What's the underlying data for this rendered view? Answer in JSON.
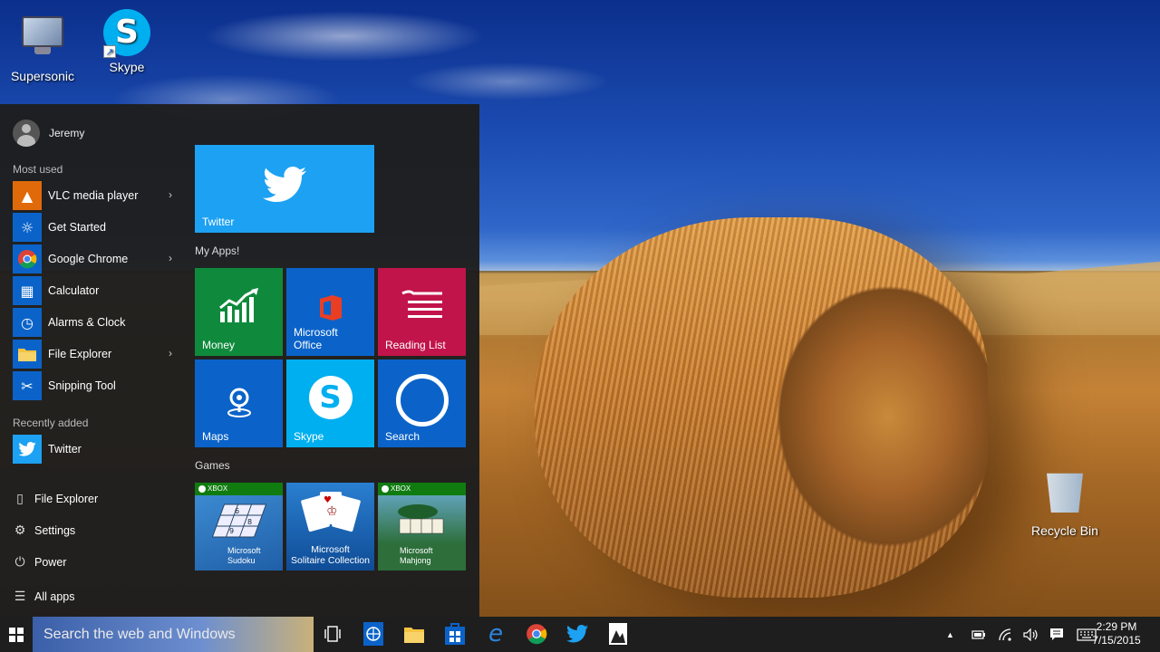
{
  "desktop": {
    "icons": [
      {
        "label": "Supersonic",
        "icon": "computer-icon"
      },
      {
        "label": "Skype",
        "icon": "skype-icon"
      },
      {
        "label": "Recycle Bin",
        "icon": "recycle-bin-icon"
      }
    ]
  },
  "start_menu": {
    "user": "Jeremy",
    "most_used_label": "Most used",
    "most_used": [
      {
        "label": "VLC media player",
        "icon": "vlc-icon",
        "color": "#e06a0a",
        "has_submenu": true
      },
      {
        "label": "Get Started",
        "icon": "lightbulb-icon",
        "color": "#0b63c9",
        "has_submenu": false
      },
      {
        "label": "Google Chrome",
        "icon": "chrome-icon",
        "color": "#0b63c9",
        "has_submenu": true
      },
      {
        "label": "Calculator",
        "icon": "calculator-icon",
        "color": "#0b63c9",
        "has_submenu": false
      },
      {
        "label": "Alarms & Clock",
        "icon": "alarm-clock-icon",
        "color": "#0b63c9",
        "has_submenu": false
      },
      {
        "label": "File Explorer",
        "icon": "folder-icon",
        "color": "#0b63c9",
        "has_submenu": true
      },
      {
        "label": "Snipping Tool",
        "icon": "scissors-icon",
        "color": "#0b63c9",
        "has_submenu": false
      }
    ],
    "recently_added_label": "Recently added",
    "recently_added": [
      {
        "label": "Twitter",
        "icon": "twitter-icon",
        "color": "#1da1f2"
      }
    ],
    "bottom": [
      {
        "label": "File Explorer",
        "icon": "file-explorer-icon"
      },
      {
        "label": "Settings",
        "icon": "gear-icon"
      },
      {
        "label": "Power",
        "icon": "power-icon"
      },
      {
        "label": "All apps",
        "icon": "list-icon"
      }
    ],
    "tiles": {
      "twitter": {
        "label": "Twitter",
        "color": "#1da1f2"
      },
      "my_apps_label": "My Apps!",
      "my_apps": [
        {
          "label": "Money",
          "color": "#0f8a3c",
          "icon": "money-chart-icon"
        },
        {
          "label": "Microsoft\nOffice",
          "color": "#0b63c9",
          "icon": "office-icon"
        },
        {
          "label": "Reading List",
          "color": "#c1144a",
          "icon": "reading-list-icon"
        },
        {
          "label": "Maps",
          "color": "#0b63c9",
          "icon": "maps-pin-icon"
        },
        {
          "label": "Skype",
          "color": "#00aff0",
          "icon": "skype-icon"
        },
        {
          "label": "Search",
          "color": "#0b63c9",
          "icon": "cortana-icon"
        }
      ],
      "games_label": "Games",
      "games": [
        {
          "label": "Microsoft\nSudoku",
          "badge": "XBOX",
          "color": "#2a7bc4"
        },
        {
          "label": "Microsoft\nSolitaire Collection",
          "badge": "",
          "color": "#1a6ab5"
        },
        {
          "label": "Microsoft\nMahjong",
          "badge": "XBOX",
          "color": "#2d6e3a"
        }
      ]
    }
  },
  "taskbar": {
    "search_placeholder": "Search the web and Windows",
    "pinned": [
      {
        "name": "task-view-icon",
        "glyph": "▯"
      },
      {
        "name": "edge-globe-icon",
        "glyph": "◍"
      },
      {
        "name": "file-explorer-icon",
        "glyph": "▬"
      },
      {
        "name": "store-icon",
        "glyph": "◫"
      },
      {
        "name": "internet-explorer-icon",
        "glyph": "e"
      },
      {
        "name": "chrome-icon",
        "glyph": "●"
      },
      {
        "name": "twitter-icon",
        "glyph": "🐦"
      },
      {
        "name": "photos-icon",
        "glyph": "▲"
      }
    ],
    "tray": [
      {
        "name": "show-hidden-icons-icon",
        "glyph": "▲"
      },
      {
        "name": "battery-icon",
        "glyph": "▭"
      },
      {
        "name": "wifi-icon",
        "glyph": "◔"
      },
      {
        "name": "volume-icon",
        "glyph": "🔈"
      },
      {
        "name": "action-center-icon",
        "glyph": "▤"
      },
      {
        "name": "keyboard-icon",
        "glyph": "⌨"
      }
    ],
    "time": "2:29 PM",
    "date": "7/15/2015"
  }
}
